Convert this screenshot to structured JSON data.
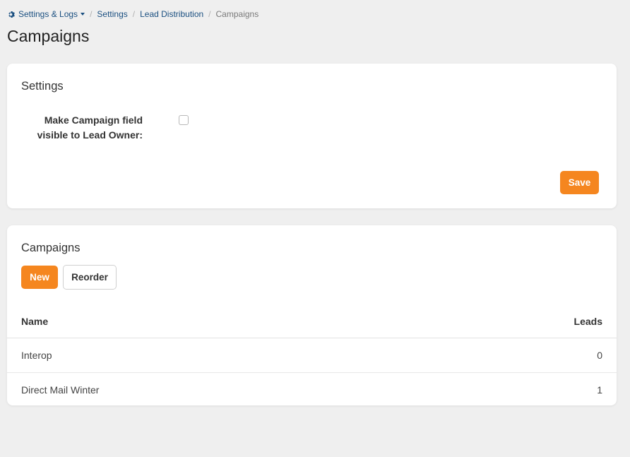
{
  "breadcrumb": {
    "root_label": "Settings & Logs",
    "root_icon": "gear-icon",
    "items": [
      {
        "label": "Settings"
      },
      {
        "label": "Lead Distribution"
      }
    ],
    "current": "Campaigns",
    "separator": "/"
  },
  "page": {
    "title": "Campaigns"
  },
  "settings_card": {
    "title": "Settings",
    "field_label_line1": "Make Campaign field",
    "field_label_line2": "visible to Lead Owner:",
    "checkbox_checked": false,
    "save_label": "Save"
  },
  "campaigns_card": {
    "title": "Campaigns",
    "new_label": "New",
    "reorder_label": "Reorder",
    "columns": {
      "name": "Name",
      "leads": "Leads"
    },
    "rows": [
      {
        "name": "Interop",
        "leads": "0"
      },
      {
        "name": "Direct Mail Winter",
        "leads": "1"
      }
    ]
  },
  "colors": {
    "accent": "#f5861f",
    "link": "#1a4f80",
    "background": "#efefef"
  }
}
